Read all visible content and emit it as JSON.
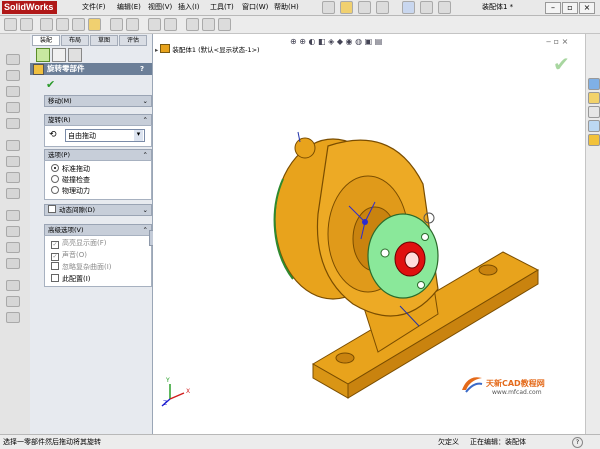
{
  "app": {
    "logo_text": "SolidWorks",
    "document_title": "装配体1 *"
  },
  "menu": [
    "文件(F)",
    "编辑(E)",
    "视图(V)",
    "插入(I)",
    "工具(T)",
    "窗口(W)",
    "帮助(H)"
  ],
  "panel": {
    "tabs": [
      "装配",
      "布局",
      "草图",
      "评估"
    ],
    "title": "旋转零部件",
    "help_glyph": "?",
    "ok_glyph": "✔",
    "sections": {
      "move": {
        "label": "移动(M)"
      },
      "rotate": {
        "label": "旋转(R)",
        "mode_value": "自由拖动"
      },
      "options": {
        "label": "选项(P)",
        "items": [
          "标准拖动",
          "碰撞检查",
          "物理动力"
        ],
        "selected": 0
      },
      "dynamic_clearance": {
        "label": "动态间隙(D)"
      },
      "advanced": {
        "label": "高级选项(V)",
        "items": [
          "高亮显示面(F)",
          "声音(O)",
          "忽略复杂曲面(I)",
          "此配置(I)"
        ]
      }
    }
  },
  "viewport": {
    "breadcrumb": "装配体1 (默认<显示状态-1>)",
    "confirm_glyph": "✔",
    "watermark_title": "天新CAD教程网",
    "watermark_url": "www.mfcad.com",
    "triad_labels": {
      "x": "X",
      "y": "Y",
      "z": "Z"
    }
  },
  "status": {
    "message": "选择一零部件然后拖动将其旋转",
    "constraint": "欠定义",
    "editing": "正在编辑：装配体",
    "help_glyph": "?"
  },
  "colors": {
    "part_gold": "#e8a31c",
    "selected_face": "#8ae89a",
    "highlight_red": "#e01010",
    "title_bar": "#6c7f98"
  }
}
